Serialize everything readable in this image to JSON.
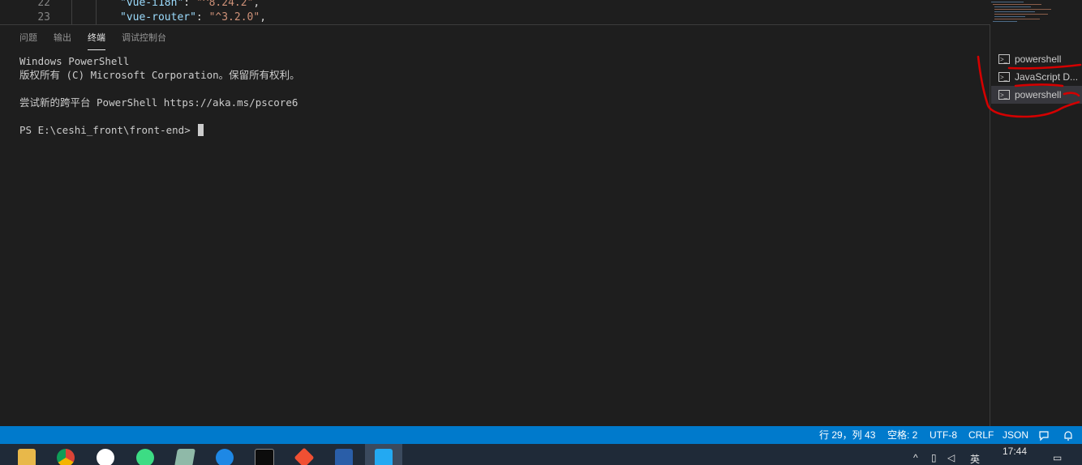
{
  "editor": {
    "lines": [
      {
        "number": "22",
        "key": "\"vue-i18n\"",
        "sep": ": ",
        "value": "\"^8.24.2\"",
        "trail": ","
      },
      {
        "number": "23",
        "key": "\"vue-router\"",
        "sep": ": ",
        "value": "\"^3.2.0\"",
        "trail": ","
      }
    ]
  },
  "panel": {
    "tabs": [
      "问题",
      "输出",
      "终端",
      "调试控制台"
    ],
    "active_tab": "终端",
    "actions": {
      "new_terminal": "+",
      "dropdown": "⌄",
      "maximize": "^",
      "close": "✕"
    }
  },
  "terminal": {
    "lines": [
      "Windows PowerShell",
      "版权所有 (C) Microsoft Corporation。保留所有权利。",
      "",
      "尝试新的跨平台 PowerShell https://aka.ms/pscore6",
      ""
    ],
    "prompt": "PS E:\\ceshi_front\\front-end> "
  },
  "terminal_list": {
    "items": [
      {
        "label": "powershell",
        "selected": false
      },
      {
        "label": "JavaScript D...",
        "selected": false
      },
      {
        "label": "powershell",
        "selected": true
      }
    ]
  },
  "status_bar": {
    "position": "行 29，列 43",
    "spaces": "空格: 2",
    "encoding": "UTF-8",
    "eol": "CRLF",
    "language": "JSON",
    "accent_color": "#007acc"
  },
  "taskbar": {
    "apps": [
      "file-explorer-icon",
      "chrome-icon",
      "wps-icon",
      "android-studio-icon",
      "notes-icon",
      "feishu-icon",
      "cmd-icon",
      "git-icon",
      "powershell-icon",
      "vscode-icon"
    ],
    "ime": "英",
    "time": "17:44"
  },
  "annotation_color": "#d40000"
}
